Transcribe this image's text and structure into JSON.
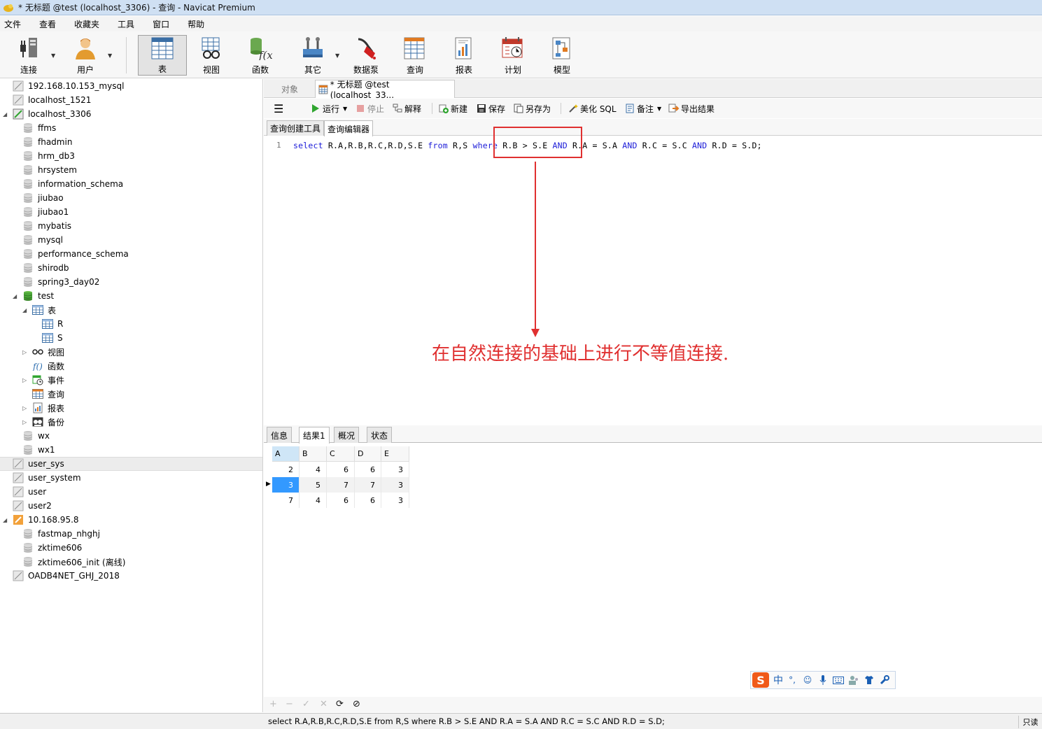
{
  "window": {
    "title": "* 无标题 @test (localhost_3306) - 查询 - Navicat Premium"
  },
  "menu": [
    "文件",
    "查看",
    "收藏夹",
    "工具",
    "窗口",
    "帮助"
  ],
  "toolbar": {
    "connect": "连接",
    "user": "用户",
    "table": "表",
    "view": "视图",
    "function": "函数",
    "other": "其它",
    "datasource": "数据泵",
    "query": "查询",
    "report": "报表",
    "schedule": "计划",
    "model": "模型"
  },
  "tree": [
    {
      "label": "192.168.10.153_mysql",
      "level": 0,
      "icon": "server-icon"
    },
    {
      "label": "localhost_1521",
      "level": 0,
      "icon": "server-icon"
    },
    {
      "label": "localhost_3306",
      "level": 0,
      "icon": "server-open-icon",
      "expanded": true
    },
    {
      "label": "ffms",
      "level": 1,
      "icon": "database-icon"
    },
    {
      "label": "fhadmin",
      "level": 1,
      "icon": "database-icon"
    },
    {
      "label": "hrm_db3",
      "level": 1,
      "icon": "database-icon"
    },
    {
      "label": "hrsystem",
      "level": 1,
      "icon": "database-icon"
    },
    {
      "label": "information_schema",
      "level": 1,
      "icon": "database-icon"
    },
    {
      "label": "jiubao",
      "level": 1,
      "icon": "database-icon"
    },
    {
      "label": "jiubao1",
      "level": 1,
      "icon": "database-icon"
    },
    {
      "label": "mybatis",
      "level": 1,
      "icon": "database-icon"
    },
    {
      "label": "mysql",
      "level": 1,
      "icon": "database-icon"
    },
    {
      "label": "performance_schema",
      "level": 1,
      "icon": "database-icon"
    },
    {
      "label": "shirodb",
      "level": 1,
      "icon": "database-icon"
    },
    {
      "label": "spring3_day02",
      "level": 1,
      "icon": "database-icon"
    },
    {
      "label": "test",
      "level": 1,
      "icon": "database-open-icon",
      "expanded": true
    },
    {
      "label": "表",
      "level": 2,
      "icon": "table-icon",
      "expanded": true
    },
    {
      "label": "R",
      "level": 3,
      "icon": "table-icon"
    },
    {
      "label": "S",
      "level": 3,
      "icon": "table-icon"
    },
    {
      "label": "视图",
      "level": 2,
      "icon": "view-icon",
      "collapsed": true
    },
    {
      "label": "函数",
      "level": 2,
      "icon": "function-icon"
    },
    {
      "label": "事件",
      "level": 2,
      "icon": "event-icon",
      "collapsed": true
    },
    {
      "label": "查询",
      "level": 2,
      "icon": "query-icon"
    },
    {
      "label": "报表",
      "level": 2,
      "icon": "report-icon",
      "collapsed": true
    },
    {
      "label": "备份",
      "level": 2,
      "icon": "backup-icon",
      "collapsed": true
    },
    {
      "label": "wx",
      "level": 1,
      "icon": "database-icon"
    },
    {
      "label": "wx1",
      "level": 1,
      "icon": "database-icon"
    },
    {
      "label": "user_sys",
      "level": 0,
      "icon": "server-icon",
      "selected": true
    },
    {
      "label": "user_system",
      "level": 0,
      "icon": "server-icon"
    },
    {
      "label": "user",
      "level": 0,
      "icon": "server-icon"
    },
    {
      "label": "user2",
      "level": 0,
      "icon": "server-icon"
    },
    {
      "label": "10.168.95.8",
      "level": 0,
      "icon": "server-oracle-icon",
      "expanded": true
    },
    {
      "label": "fastmap_nhghj",
      "level": 1,
      "icon": "database-icon"
    },
    {
      "label": "zktime606",
      "level": 1,
      "icon": "database-icon"
    },
    {
      "label": "zktime606_init (离线)",
      "level": 1,
      "icon": "database-icon"
    },
    {
      "label": "OADB4NET_GHJ_2018",
      "level": 0,
      "icon": "server-icon"
    }
  ],
  "tabs": {
    "objects": "对象",
    "query": "* 无标题 @test (localhost_33..."
  },
  "query_toolbar": {
    "run": "运行",
    "stop": "停止",
    "explain": "解释",
    "new": "新建",
    "save": "保存",
    "save_as": "另存为",
    "beautify": "美化 SQL",
    "comment": "备注",
    "export": "导出结果"
  },
  "editor_tabs": {
    "builder": "查询创建工具",
    "editor": "查询编辑器"
  },
  "editor": {
    "line_number": "1",
    "sql_parts": [
      {
        "t": "select",
        "kw": true
      },
      {
        "t": " R.A,R.B,R.C,R.D,S.E ",
        "kw": false
      },
      {
        "t": "from",
        "kw": true
      },
      {
        "t": " R,S ",
        "kw": false
      },
      {
        "t": "where",
        "kw": true
      },
      {
        "t": " R.B > S.E ",
        "kw": false
      },
      {
        "t": "AND",
        "kw": true
      },
      {
        "t": " R.A = S.A ",
        "kw": false
      },
      {
        "t": "AND",
        "kw": true
      },
      {
        "t": " R.C = S.C ",
        "kw": false
      },
      {
        "t": "AND",
        "kw": true
      },
      {
        "t": " R.D = S.D;",
        "kw": false
      }
    ],
    "annotation": "在自然连接的基础上进行不等值连接.",
    "annotation_color": "#e03030"
  },
  "result_tabs": [
    "信息",
    "结果1",
    "概况",
    "状态"
  ],
  "result": {
    "columns": [
      "A",
      "B",
      "C",
      "D",
      "E"
    ],
    "rows": [
      [
        "2",
        "4",
        "6",
        "6",
        "3"
      ],
      [
        "3",
        "5",
        "7",
        "7",
        "3"
      ],
      [
        "7",
        "4",
        "6",
        "6",
        "3"
      ]
    ]
  },
  "ime": {
    "logo": "S",
    "mode": "中"
  },
  "grid_toolbar": [
    "+",
    "−",
    "✓",
    "✕",
    "⟳",
    "⊘"
  ],
  "status": {
    "sql": "select R.A,R.B,R.C,R.D,S.E from R,S where R.B  > S.E AND R.A = S.A AND R.C = S.C AND R.D = S.D;",
    "mode": "只读"
  }
}
